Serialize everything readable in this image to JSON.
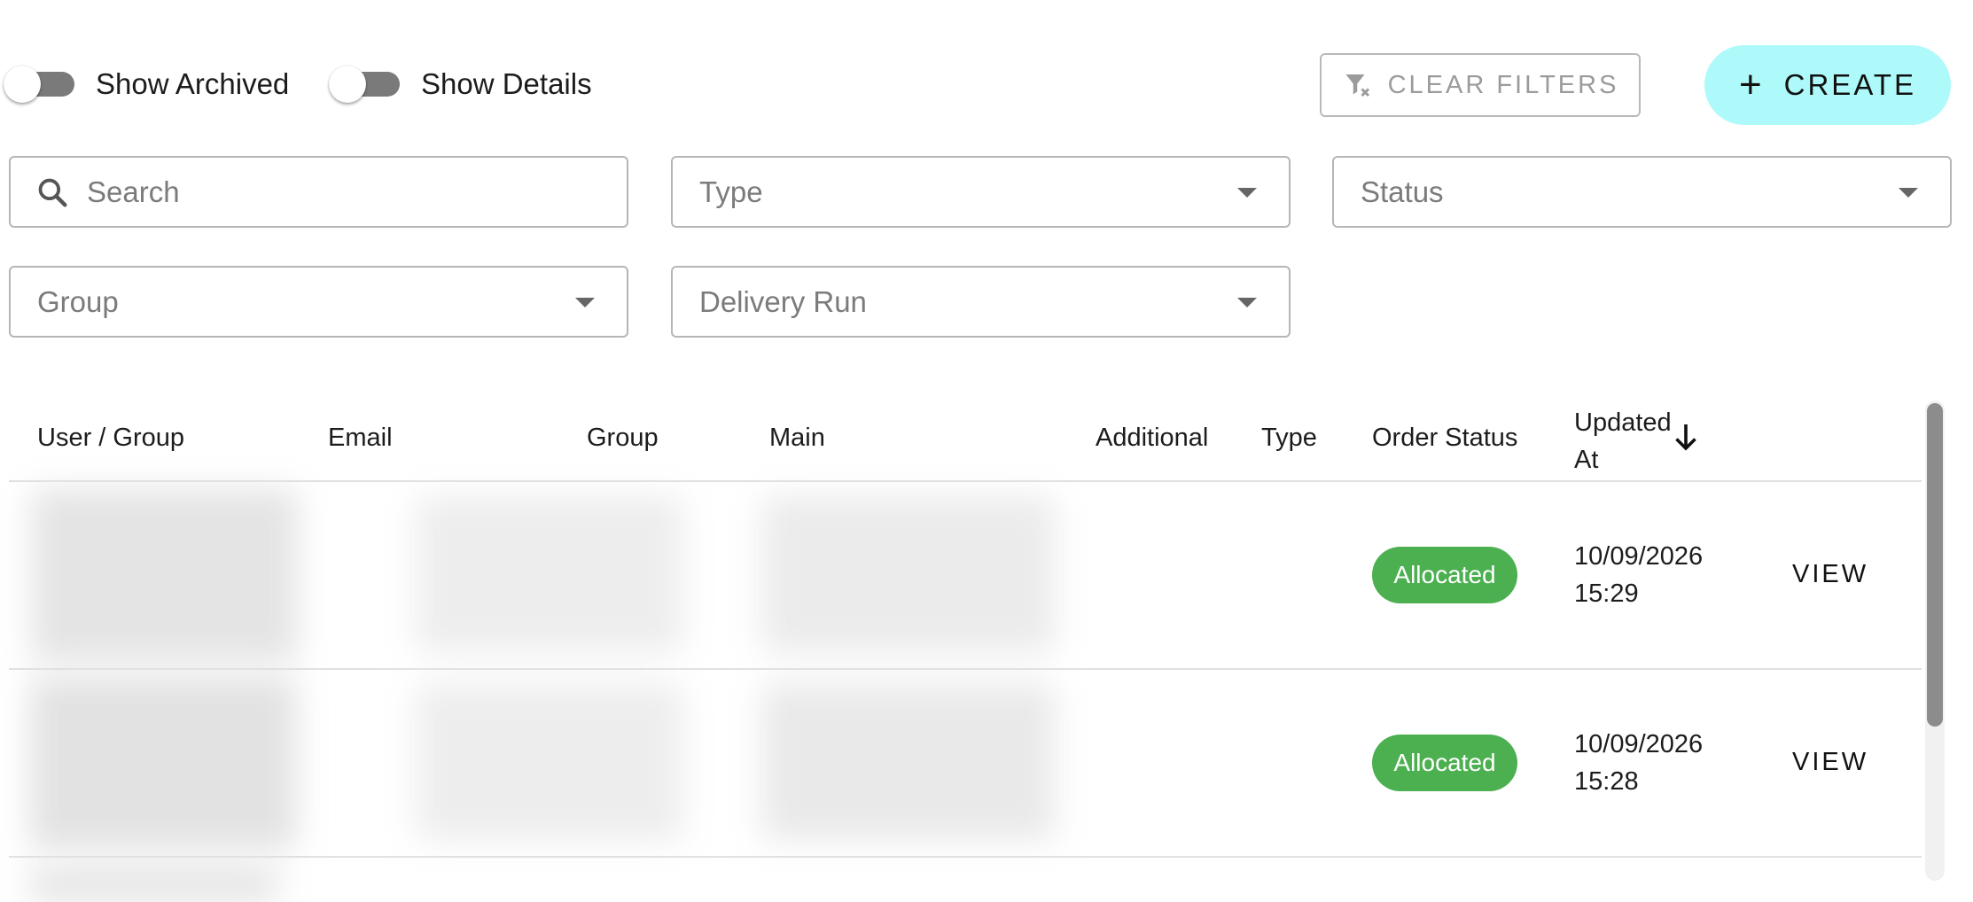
{
  "toggles": {
    "archived_label": "Show Archived",
    "details_label": "Show Details"
  },
  "actions": {
    "clear_filters_label": "CLEAR FILTERS",
    "create_label": "CREATE",
    "create_icon": "plus-icon",
    "clear_icon": "filter-off-icon"
  },
  "filters": {
    "search_placeholder": "Search",
    "type_label": "Type",
    "status_label": "Status",
    "group_label": "Group",
    "delivery_run_label": "Delivery Run"
  },
  "table": {
    "columns": [
      "User / Group",
      "Email",
      "Group",
      "Main",
      "Additional",
      "Type",
      "Order Status",
      "Updated At"
    ],
    "sort_icon": "arrow-down-icon",
    "rows": [
      {
        "status": "Allocated",
        "updated_date": "10/09/2026",
        "updated_time": "15:29",
        "action": "VIEW"
      },
      {
        "status": "Allocated",
        "updated_date": "10/09/2026",
        "updated_time": "15:28",
        "action": "VIEW"
      }
    ]
  },
  "colors": {
    "create_bg": "#aefafa",
    "status_allocated": "#4caf50"
  }
}
